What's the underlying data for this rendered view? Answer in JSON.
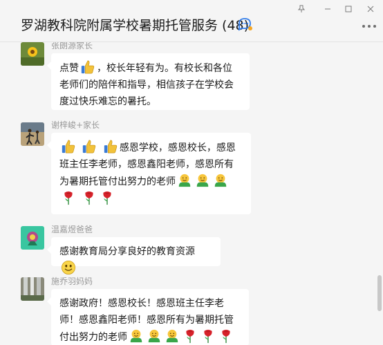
{
  "header": {
    "title": "罗湖教科院附属学校暑期托管服务 (48)",
    "window_controls": [
      "pin-icon",
      "minimize-icon",
      "maximize-icon",
      "close-icon"
    ],
    "more_icon": "more-icon"
  },
  "messages": [
    {
      "sender": "张朗源家长",
      "parts": [
        "点赞",
        "{thumbs}",
        "，校长年轻有为。有校长和各位老师们的陪伴和指导，相信孩子在学校会度过快乐难忘的暑托。"
      ]
    },
    {
      "sender": "谢梓峻+家长",
      "line1_text": "感恩学校，感恩校长，感恩班主任李老师，感恩鑫阳老师，感恩所有为暑期托管付出努力的老师"
    },
    {
      "sender": "温嘉煜爸爸",
      "text": "感谢教育局分享良好的教育资源"
    },
    {
      "sender": "施乔羽妈妈",
      "text": "感谢政府！感恩校长！感恩班主任李老师！感恩鑫阳老师！感恩所有为暑期托管付出努力的老师"
    }
  ],
  "colors": {
    "background": "#f5f5f5",
    "bubble": "#ffffff",
    "sender": "#9a9a9a",
    "accent": "#2f7bea"
  }
}
